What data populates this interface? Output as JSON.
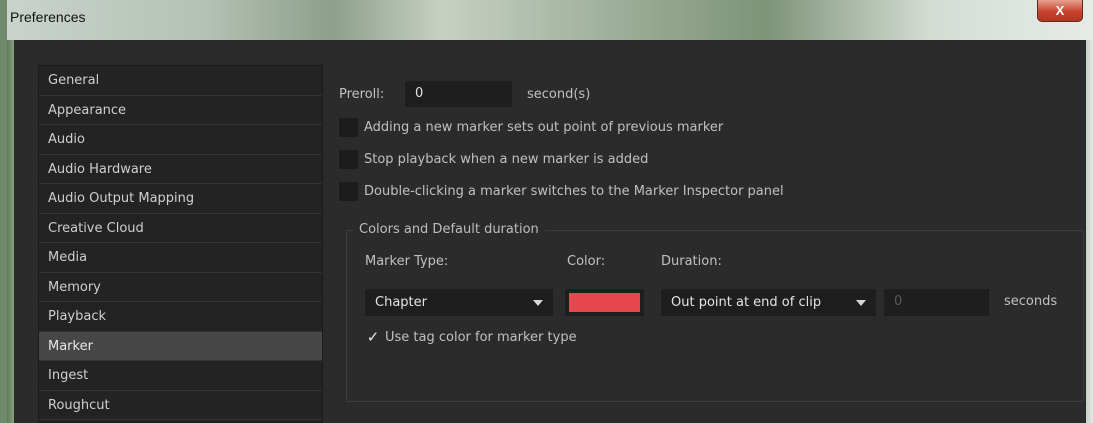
{
  "window": {
    "title": "Preferences",
    "close_label": "X"
  },
  "sidebar": {
    "items": [
      {
        "label": "General"
      },
      {
        "label": "Appearance"
      },
      {
        "label": "Audio"
      },
      {
        "label": "Audio Hardware"
      },
      {
        "label": "Audio Output Mapping"
      },
      {
        "label": "Creative Cloud"
      },
      {
        "label": "Media"
      },
      {
        "label": "Memory"
      },
      {
        "label": "Playback"
      },
      {
        "label": "Marker",
        "selected": true
      },
      {
        "label": "Ingest"
      },
      {
        "label": "Roughcut"
      }
    ]
  },
  "marker": {
    "preroll_label": "Preroll:",
    "preroll_value": "0",
    "preroll_unit": "second(s)",
    "checkboxes": [
      {
        "label": "Adding a new marker sets out point of previous marker",
        "checked": false
      },
      {
        "label": "Stop playback when a new marker is added",
        "checked": false
      },
      {
        "label": "Double-clicking a marker switches to the Marker Inspector panel",
        "checked": false
      }
    ],
    "group": {
      "legend": "Colors and Default duration",
      "marker_type_label": "Marker Type:",
      "color_label": "Color:",
      "duration_label": "Duration:",
      "marker_type_value": "Chapter",
      "color_value": "#e5484d",
      "duration_value": "Out point at end of clip",
      "duration_seconds_value": "0",
      "seconds_label": "seconds",
      "use_tag_color_label": "Use tag color for marker type",
      "use_tag_color_checked": true,
      "check_glyph": "✓"
    }
  }
}
